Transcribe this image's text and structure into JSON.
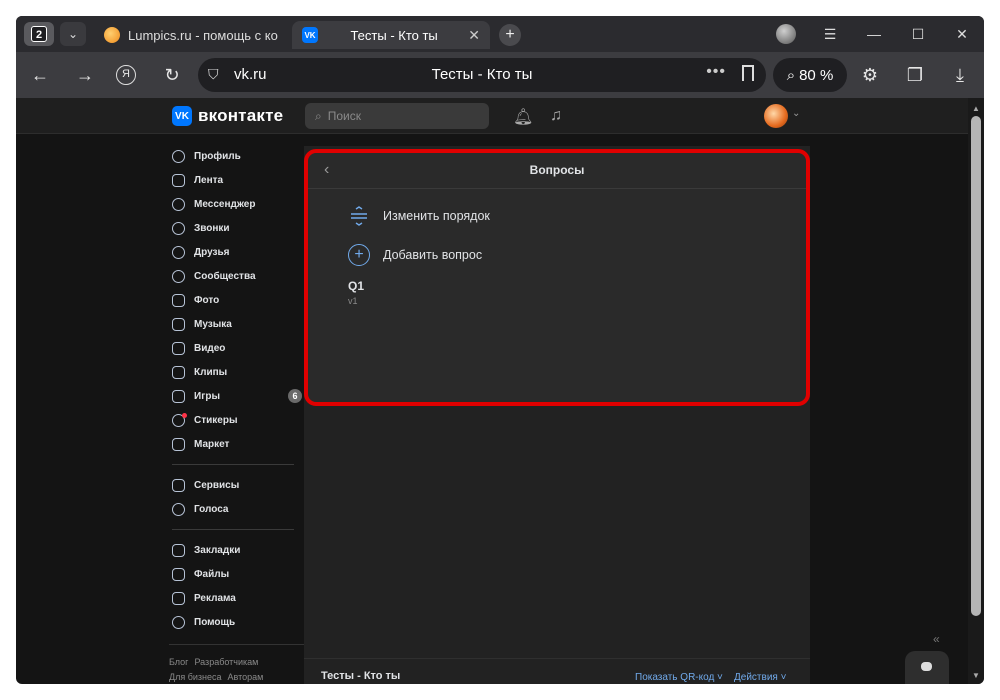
{
  "browser": {
    "tab_count": "2",
    "tabs": [
      {
        "label": "Lumpics.ru - помощь с ко",
        "close": "✕"
      },
      {
        "label": "Тесты - Кто ты",
        "close": "✕"
      }
    ],
    "new_tab": "+",
    "window_controls": {
      "menu": "☰",
      "minimize": "—",
      "maximize": "☐",
      "close": "✕"
    },
    "nav": {
      "back": "←",
      "forward": "→",
      "yandex": "Я",
      "reload": "↻"
    },
    "address": {
      "domain": "vk.ru",
      "page_title": "Тесты - Кто ты",
      "more": "•••"
    },
    "zoom": "80 %",
    "toolbar_icons": [
      "extensions-icon",
      "collections-icon",
      "download-icon"
    ]
  },
  "vk": {
    "logo_text": "вконтакте",
    "logo_mark": "VK",
    "search_placeholder": "Поиск",
    "menu": [
      {
        "label": "Профиль",
        "icon": "profile-icon"
      },
      {
        "label": "Лента",
        "icon": "feed-icon"
      },
      {
        "label": "Мессенджер",
        "icon": "messenger-icon"
      },
      {
        "label": "Звонки",
        "icon": "calls-icon"
      },
      {
        "label": "Друзья",
        "icon": "friends-icon"
      },
      {
        "label": "Сообщества",
        "icon": "communities-icon"
      },
      {
        "label": "Фото",
        "icon": "photo-icon"
      },
      {
        "label": "Музыка",
        "icon": "music-icon"
      },
      {
        "label": "Видео",
        "icon": "video-icon"
      },
      {
        "label": "Клипы",
        "icon": "clips-icon"
      },
      {
        "label": "Игры",
        "icon": "games-icon",
        "badge": "6"
      },
      {
        "label": "Стикеры",
        "icon": "stickers-icon"
      },
      {
        "label": "Маркет",
        "icon": "market-icon"
      }
    ],
    "menu2": [
      {
        "label": "Сервисы",
        "icon": "services-icon"
      },
      {
        "label": "Голоса",
        "icon": "votes-icon"
      }
    ],
    "menu3": [
      {
        "label": "Закладки",
        "icon": "bookmarks-icon"
      },
      {
        "label": "Файлы",
        "icon": "files-icon"
      },
      {
        "label": "Реклама",
        "icon": "ads-icon"
      },
      {
        "label": "Помощь",
        "icon": "help-icon"
      }
    ],
    "footer": [
      "Блог",
      "Разработчикам",
      "Для бизнеса",
      "Авторам"
    ]
  },
  "modal": {
    "title": "Вопросы",
    "change_order": "Изменить порядок",
    "add_question": "Добавить вопрос",
    "question": {
      "title": "Q1",
      "subtitle": "v1"
    },
    "highlight_color": "#e00000"
  },
  "content_footer": {
    "title": "Тесты - Кто ты",
    "qr": "Показать QR-код ˅",
    "actions": "Действия ˅"
  }
}
